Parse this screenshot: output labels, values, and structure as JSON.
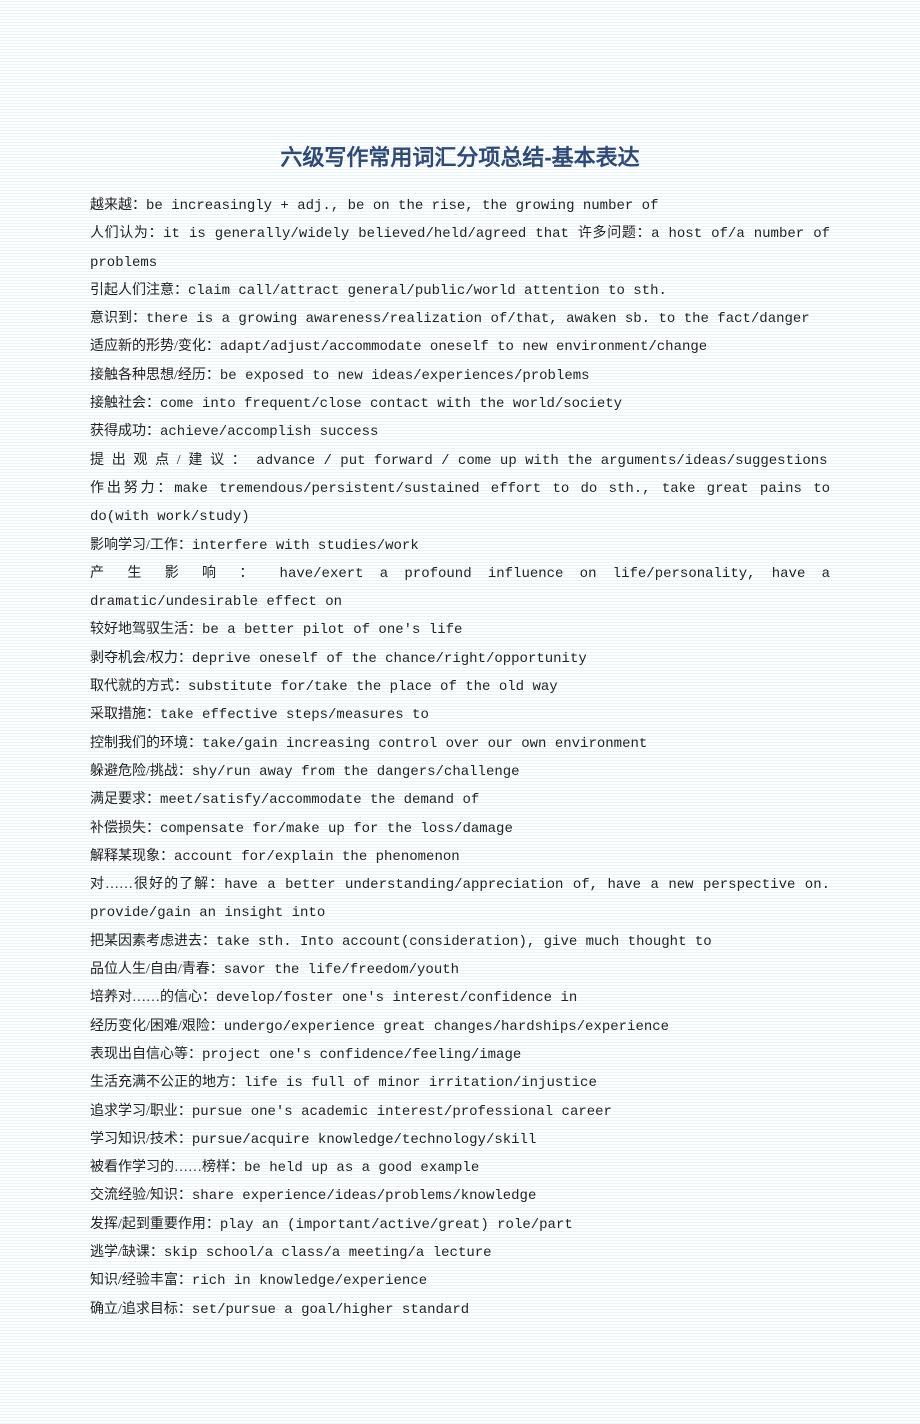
{
  "title": "六级写作常用词汇分项总结-基本表达",
  "entries": [
    {
      "cn": "越来越：",
      "en": "be increasingly + adj.,   be on the rise,   the growing number of"
    },
    {
      "cn": "人们认为：",
      "en": "it is   generally/widely   believed/held/agreed   that 许多问题：a host of/a number of   problems"
    },
    {
      "cn": "引起人们注意：",
      "en": "claim call/attract general/public/world attention to sth."
    },
    {
      "cn": "意识到：",
      "en": "there is a growing awareness/realization of/that,   awaken sb. to the fact/danger"
    },
    {
      "cn": "适应新的形势/变化：",
      "en": "adapt/adjust/accommodate oneself to new environment/change"
    },
    {
      "cn": "接触各种思想/经历：",
      "en": "be exposed to new ideas/experiences/problems"
    },
    {
      "cn": "接触社会：",
      "en": "come into frequent/close contact with the world/society"
    },
    {
      "cn": "获得成功：",
      "en": "achieve/accomplish success"
    },
    {
      "cn": "提 出 观 点 / 建 议 ：",
      "en": " advance  /  put  forward  /  come  up  with    the arguments/ideas/suggestions",
      "sparse": true
    },
    {
      "cn": "作出努力：",
      "en": "make tremendous/persistent/sustained effort to do sth., take great pains to do(with work/study)"
    },
    {
      "cn": "影响学习/工作：",
      "en": "interfere with studies/work"
    },
    {
      "cn": "产 生 影 响 ：",
      "en": " have/exert  a  profound  influence  on  life/personality,  have  a dramatic/undesirable effect on",
      "sparse": true
    },
    {
      "cn": "较好地驾驭生活：",
      "en": "be a better pilot of one's life"
    },
    {
      "cn": "剥夺机会/权力：",
      "en": "deprive oneself of the chance/right/opportunity"
    },
    {
      "cn": "取代就的方式：",
      "en": "substitute for/take the place of the old way"
    },
    {
      "cn": "采取措施：",
      "en": "take effective steps/measures to"
    },
    {
      "cn": "控制我们的环境：",
      "en": "take/gain increasing control over our own environment"
    },
    {
      "cn": "躲避危险/挑战：",
      "en": "shy/run away from the dangers/challenge"
    },
    {
      "cn": "满足要求：",
      "en": "meet/satisfy/accommodate the demand of"
    },
    {
      "cn": "补偿损失：",
      "en": "compensate for/make up for the loss/damage"
    },
    {
      "cn": "解释某现象：",
      "en": "account for/explain the phenomenon"
    },
    {
      "cn": "对……很好的了解：",
      "en": "have a better understanding/appreciation of, have a new perspective on. provide/gain an insight into"
    },
    {
      "cn": "把某因素考虑进去：",
      "en": "take sth. Into account(consideration), give much thought to"
    },
    {
      "cn": "品位人生/自由/青春：",
      "en": "savor the life/freedom/youth"
    },
    {
      "cn": "培养对……的信心：",
      "en": "develop/foster one's interest/confidence in"
    },
    {
      "cn": "经历变化/困难/艰险：",
      "en": "undergo/experience great changes/hardships/experience"
    },
    {
      "cn": "表现出自信心等：",
      "en": "project one's confidence/feeling/image"
    },
    {
      "cn": "生活充满不公正的地方：",
      "en": "life is full of minor irritation/injustice"
    },
    {
      "cn": "追求学习/职业：",
      "en": "pursue one's academic interest/professional career"
    },
    {
      "cn": "学习知识/技术：",
      "en": "pursue/acquire knowledge/technology/skill"
    },
    {
      "cn": "被看作学习的……榜样：",
      "en": "be held up as a good example"
    },
    {
      "cn": "交流经验/知识：",
      "en": "share experience/ideas/problems/knowledge"
    },
    {
      "cn": "发挥/起到重要作用：",
      "en": "play an (important/active/great) role/part"
    },
    {
      "cn": "逃学/缺课：",
      "en": "skip school/a class/a meeting/a lecture"
    },
    {
      "cn": "知识/经验丰富：",
      "en": "rich in knowledge/experience"
    },
    {
      "cn": "确立/追求目标：",
      "en": "set/pursue a goal/higher standard"
    }
  ]
}
